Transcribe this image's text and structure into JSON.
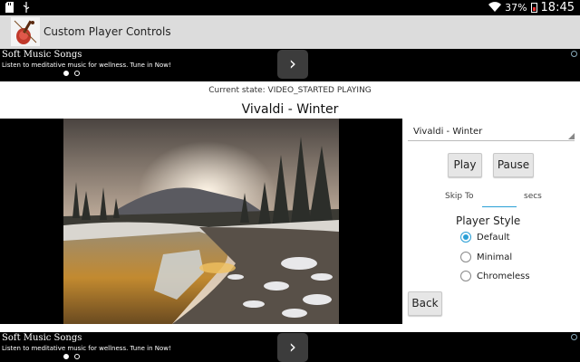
{
  "status_bar": {
    "battery": "37%",
    "time": "18:45",
    "left_icons": [
      "sd-card-icon",
      "usb-icon"
    ],
    "right_icons": [
      "wifi-icon",
      "battery-icon"
    ]
  },
  "app": {
    "title": "Custom Player Controls",
    "icon": "violin-icon"
  },
  "ads": {
    "top": {
      "title": "Soft Music Songs",
      "description": "Listen to meditative music for wellness. Tune in Now!",
      "next_glyph": "›",
      "dots": 2,
      "active_dot": 0
    },
    "bottom": {
      "title": "Soft Music Songs",
      "description": "Listen to meditative music for wellness. Tune in Now!",
      "next_glyph": "›",
      "dots": 2,
      "active_dot": 0
    }
  },
  "player": {
    "state": "Current state: VIDEO_STARTED PLAYING",
    "title": "Vivaldi -  Winter"
  },
  "controls": {
    "dropdown_value": "Vivaldi -  Winter",
    "play_label": "Play",
    "pause_label": "Pause",
    "skip_label": "Skip To",
    "skip_value": "",
    "secs_label": "secs",
    "style_heading": "Player Style",
    "styles": [
      {
        "label": "Default",
        "checked": true
      },
      {
        "label": "Minimal",
        "checked": false
      },
      {
        "label": "Chromeless",
        "checked": false
      }
    ],
    "back_label": "Back"
  },
  "colors": {
    "accent": "#2a9fd6",
    "action_bar": "#dcdcdc",
    "ad_background": "#000000"
  }
}
